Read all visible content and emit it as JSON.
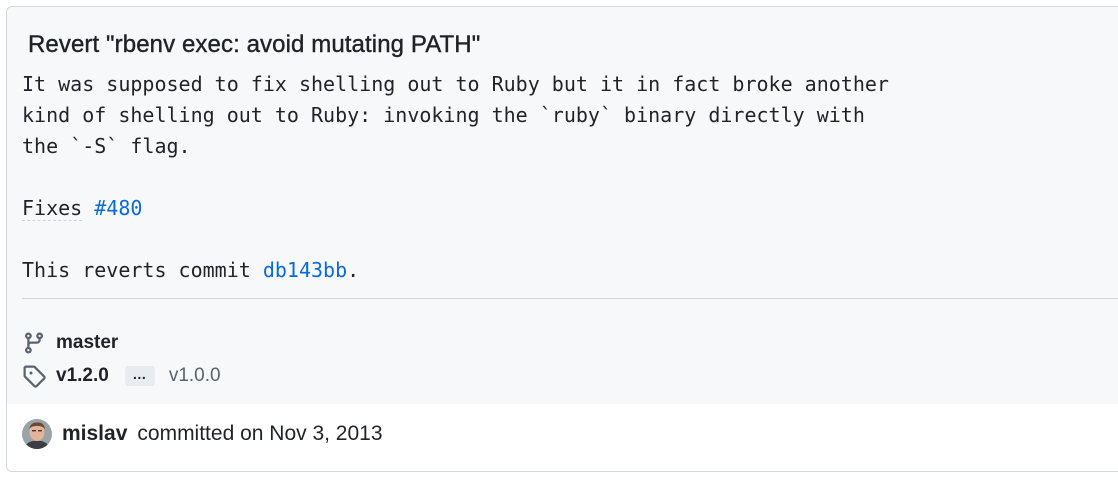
{
  "commit": {
    "title": "Revert \"rbenv exec: avoid mutating PATH\"",
    "description_lines": [
      "It was supposed to fix shelling out to Ruby but it in fact broke another",
      "kind of shelling out to Ruby: invoking the `ruby` binary directly with",
      "the `-S` flag."
    ],
    "fixes_label": "Fixes",
    "fixes_issue": "#480",
    "reverts_text": "This reverts commit",
    "reverts_sha": "db143bb",
    "reverts_period": "."
  },
  "refs": {
    "branch": "master",
    "tag": "v1.2.0",
    "ellipsis": "…",
    "tag_other": "v1.0.0"
  },
  "author": {
    "name": "mislav",
    "action": "committed on Nov 3, 2013"
  },
  "colors": {
    "link": "#0969da",
    "header_bg": "#f6f8fa",
    "border": "#d0d7de"
  },
  "icons": {
    "branch": "git-branch-icon",
    "tag": "tag-icon"
  }
}
